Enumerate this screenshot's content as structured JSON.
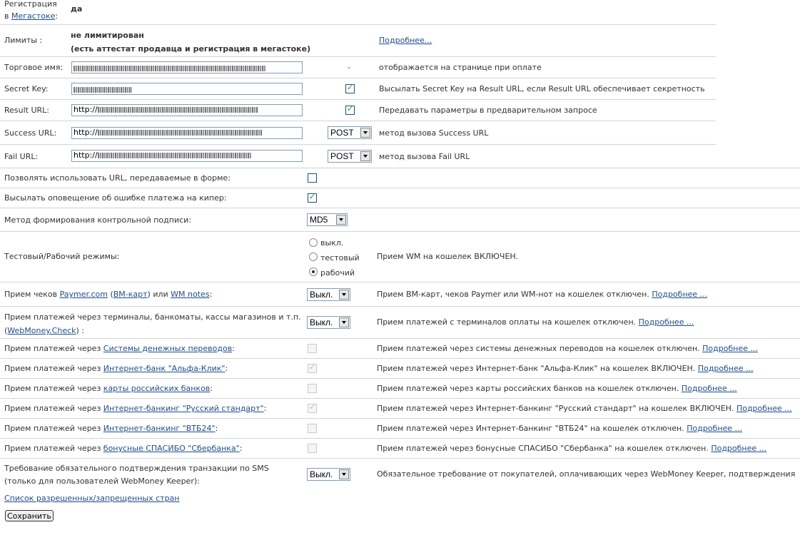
{
  "megastock": {
    "label_line1": "Регистрация",
    "label_prefix": "в ",
    "link": "Мегастоке",
    "label_suffix": ":",
    "value": "да"
  },
  "limits": {
    "label": "Лимиты :",
    "value_line1": "не лимитирован",
    "value_line2": "(есть аттестат продавца и регистрация в мегастоке)",
    "more_link": "Подробнее..."
  },
  "trade_name": {
    "label": "Торговое имя:",
    "dash": "-",
    "note": "отображается на странице при оплате"
  },
  "secret_key": {
    "label": "Secret Key:",
    "checked": true,
    "note": "Высылать Secret Key на Result URL, если Result URL обеспечивает секретность"
  },
  "result_url": {
    "label": "Result URL:",
    "prefix": "http://",
    "checked": true,
    "note": "Передавать параметры в предварительном запросе"
  },
  "success_url": {
    "label": "Success URL:",
    "prefix": "http://",
    "method": "POST",
    "note": "метод вызова Success URL"
  },
  "fail_url": {
    "label": "Fail URL:",
    "prefix": "http://",
    "method": "POST",
    "note": "метод вызова Fail URL"
  },
  "allow_form_urls": {
    "label": "Позволять использовать URL, передаваемые в форме:",
    "checked": false
  },
  "error_notify": {
    "label": "Высылать оповещение об ошибке платежа на кипер:",
    "checked": true
  },
  "signature_method": {
    "label": "Метод формирования контрольной подписи:",
    "value": "MD5"
  },
  "mode": {
    "label": "Тестовый/Рабочий режимы:",
    "options": [
      "выкл.",
      "тестовый",
      "рабочий"
    ],
    "selected": "рабочий",
    "note": "Прием WM на кошелек ВКЛЮЧЕН."
  },
  "paymer": {
    "prefix": "Прием чеков ",
    "link1": "Paymer.com",
    "mid1": " (",
    "link2": "ВМ-карт",
    "mid2": ") или ",
    "link3": "WM notes",
    "suffix": ":",
    "value": "Выкл.",
    "note": "Прием ВМ-карт, чеков Paymer или WM-нот на кошелек отключен.",
    "more": "Подробнее ..."
  },
  "terminals": {
    "line1": "Прием платежей через терминалы, банкоматы, кассы магазинов и т.п.",
    "open": "(",
    "link": "WebMoney.Check",
    "close": ") :",
    "value": "Выкл.",
    "note": "Прием платежей с терминалов оплаты на кошелек отключен.",
    "more": "Подробнее ..."
  },
  "payment_rows": [
    {
      "prefix": "Прием платежей через ",
      "link": "Системы денежных переводов",
      "suffix": ":",
      "checked": false,
      "note": "Прием платежей через системы денежных переводов на кошелек отключен.",
      "more": "Подробнее ..."
    },
    {
      "prefix": "Прием платежей через ",
      "link": "Интернет-банк \"Альфа-Клик\"",
      "suffix": ":",
      "checked": true,
      "note": "Прием платежей через Интернет-банк \"Альфа-Клик\" на кошелек ВКЛЮЧЕН.",
      "more": "Подробнее ..."
    },
    {
      "prefix": "Прием платежей через ",
      "link": "карты российских банков",
      "suffix": ":",
      "checked": false,
      "note": "Прием платежей через карты российских банков на кошелек отключен.",
      "more": "Подробнее ..."
    },
    {
      "prefix": "Прием платежей через ",
      "link": "Интернет-банкинг \"Русский стандарт\"",
      "suffix": ":",
      "checked": true,
      "note": "Прием платежей через Интернет-банкинг \"Русский стандарт\" на кошелек ВКЛЮЧЕН.",
      "more": "Подробнее ..."
    },
    {
      "prefix": "Прием платежей через ",
      "link": "Интернет-банкинг \"ВТБ24\"",
      "suffix": ":",
      "checked": false,
      "note": "Прием платежей через Интернет-банкинг \"ВТБ24\" на кошелек отключен.",
      "more": "Подробнее ..."
    },
    {
      "prefix": "Прием платежей через ",
      "link": "бонусные СПАСИБО \"Сбербанка\"",
      "suffix": ":",
      "checked": false,
      "note": "Прием платежей через бонусные СПАСИБО \"Сбербанка\" на кошелек отключен.",
      "more": "Подробнее ..."
    }
  ],
  "sms": {
    "line1": "Требование обязательного подтверждения транзакции по SMS",
    "line2": "(только для пользователей WebMoney Keeper):",
    "value": "Выкл.",
    "note": "Обязательное требование от покупателей, оплачивающих через WebMoney Keeper, подтверждения"
  },
  "countries_link": "Список разрешенных/запрещенных стран",
  "save_label": "Сохранить"
}
